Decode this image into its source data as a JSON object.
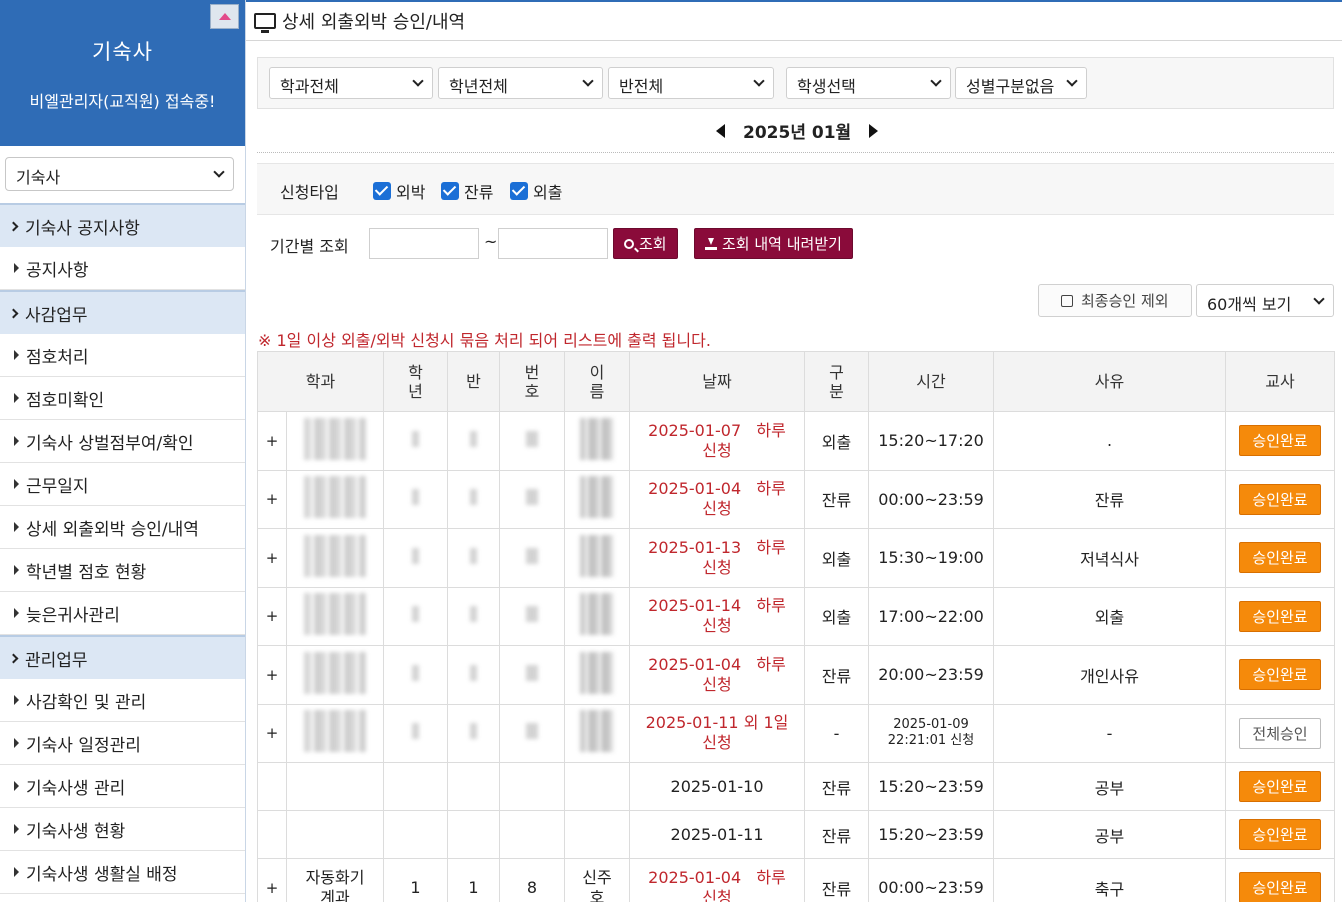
{
  "sidebar": {
    "title": "기숙사",
    "access_text": "비엘관리자(교직원) 접속중!",
    "dorm_select": "기숙사",
    "sections": [
      {
        "label": "기숙사 공지사항",
        "items": [
          "공지사항"
        ]
      },
      {
        "label": "사감업무",
        "items": [
          "점호처리",
          "점호미확인",
          "기숙사 상벌점부여/확인",
          "근무일지",
          "상세 외출외박 승인/내역",
          "학년별 점호 현황",
          "늦은귀사관리"
        ]
      },
      {
        "label": "관리업무",
        "items": [
          "사감확인 및 관리",
          "기숙사 일정관리",
          "기숙사생 관리",
          "기숙사생 현황",
          "기숙사생 생활실 배정"
        ]
      }
    ]
  },
  "page": {
    "title": "상세 외출외박 승인/내역",
    "filters": {
      "dept": "학과전체",
      "grade": "학년전체",
      "class": "반전체",
      "student": "학생선택",
      "gender": "성별구분없음"
    },
    "month": "2025년 01월",
    "type_label": "신청타입",
    "types": [
      "외박",
      "잔류",
      "외출"
    ],
    "period_label": "기간별 조회",
    "tilde": "~",
    "search_btn": "조회",
    "download_btn": "조회 내역 내려받기",
    "exclude_final": "최종승인 제외",
    "per_page": "60개씩 보기",
    "notice": "※ 1일 이상 외출/외박 신청시 묶음 처리 되어 리스트에 출력 됩니다."
  },
  "table": {
    "headers": {
      "dept": "학과",
      "grade_l1": "학",
      "grade_l2": "년",
      "class": "반",
      "num_l1": "번",
      "num_l2": "호",
      "name_l1": "이",
      "name_l2": "름",
      "date": "날짜",
      "type_l1": "구",
      "type_l2": "분",
      "time": "시간",
      "reason": "사유",
      "teacher": "교사"
    },
    "rows": [
      {
        "plus": "+",
        "date_l1": "2025-01-07   하루",
        "date_l2": "신청",
        "type": "외출",
        "time": "15:20~17:20",
        "reason": ".",
        "action": "승인완료"
      },
      {
        "plus": "+",
        "date_l1": "2025-01-04   하루",
        "date_l2": "신청",
        "type": "잔류",
        "time": "00:00~23:59",
        "reason": "잔류",
        "action": "승인완료"
      },
      {
        "plus": "+",
        "date_l1": "2025-01-13   하루",
        "date_l2": "신청",
        "type": "외출",
        "time": "15:30~19:00",
        "reason": "저녁식사",
        "action": "승인완료"
      },
      {
        "plus": "+",
        "date_l1": "2025-01-14   하루",
        "date_l2": "신청",
        "type": "외출",
        "time": "17:00~22:00",
        "reason": "외출",
        "action": "승인완료"
      },
      {
        "plus": "+",
        "date_l1": "2025-01-04   하루",
        "date_l2": "신청",
        "type": "잔류",
        "time": "20:00~23:59",
        "reason": "개인사유",
        "action": "승인완료"
      },
      {
        "plus": "+",
        "date_l1": "2025-01-11 외 1일",
        "date_l2": "신청",
        "type": "-",
        "time_l1": "2025-01-09",
        "time_l2": "22:21:01 신청",
        "reason": "-",
        "action": "전체승인"
      }
    ],
    "sub_rows": [
      {
        "date": "2025-01-10",
        "type": "잔류",
        "time": "15:20~23:59",
        "reason": "공부",
        "action": "승인완료"
      },
      {
        "date": "2025-01-11",
        "type": "잔류",
        "time": "15:20~23:59",
        "reason": "공부",
        "action": "승인완료"
      }
    ],
    "last_row": {
      "plus": "+",
      "dept_l1": "자동화기",
      "dept_l2": "계과",
      "grade": "1",
      "class": "1",
      "num": "8",
      "name_l1": "신주",
      "name_l2": "호",
      "date_l1": "2025-01-04   하루",
      "date_l2": "신청",
      "type": "잔류",
      "time": "00:00~23:59",
      "reason": "축구",
      "action": "승인완료"
    }
  }
}
